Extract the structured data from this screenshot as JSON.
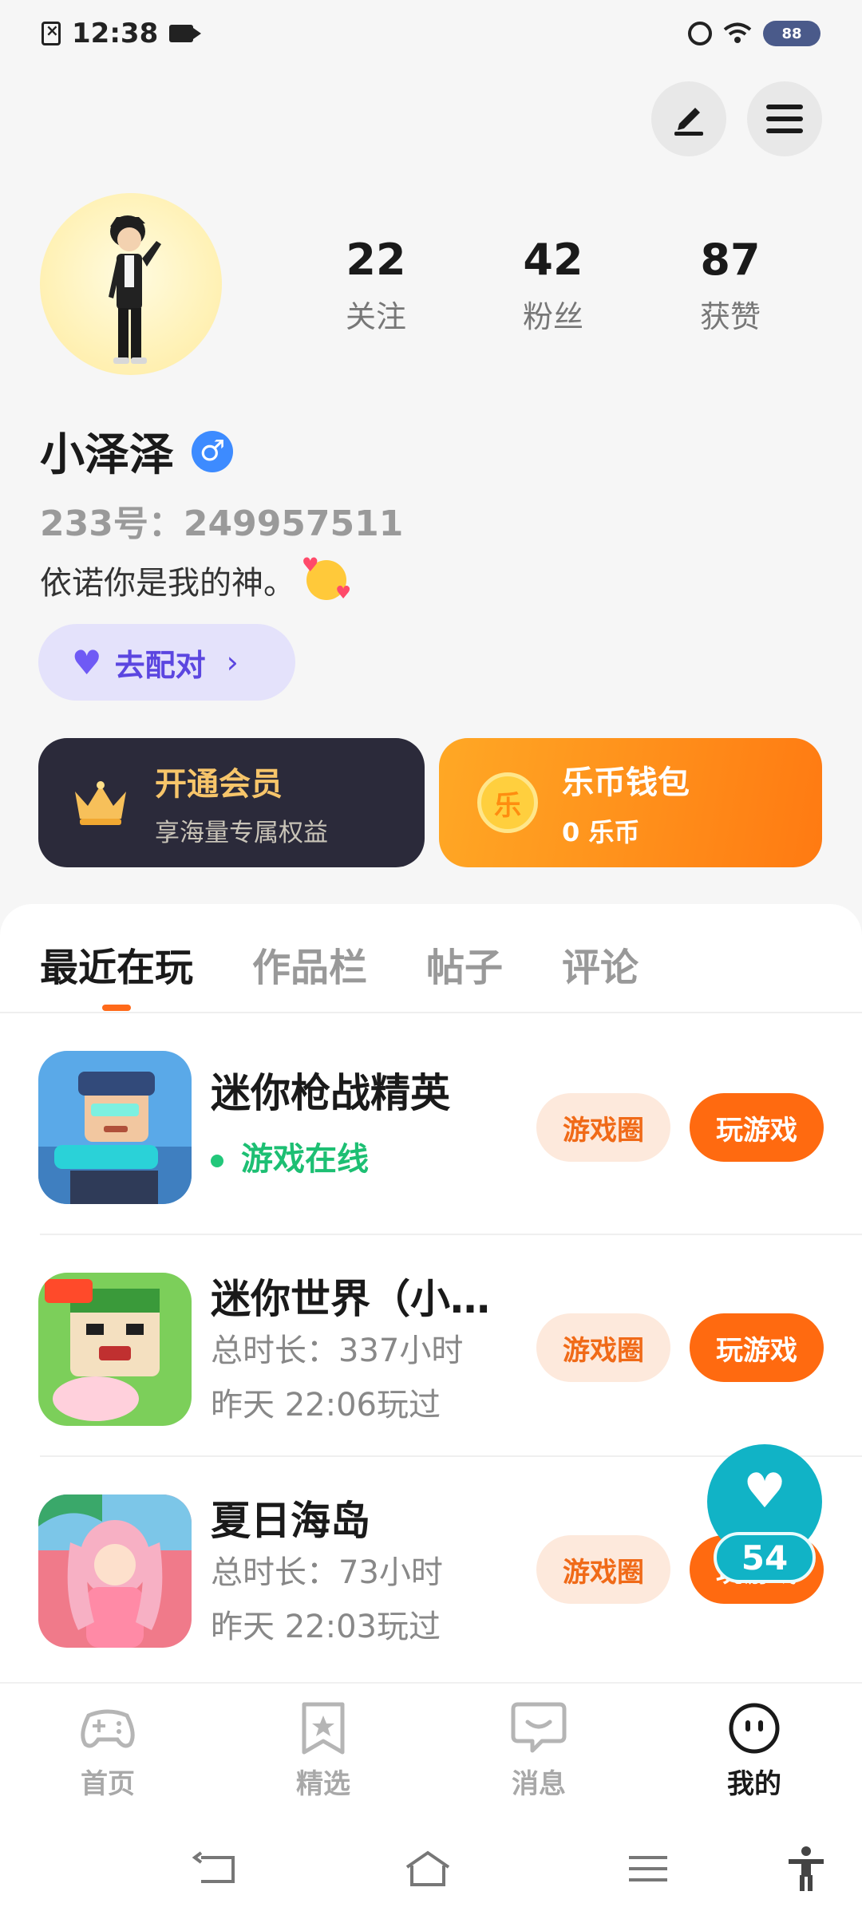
{
  "status_bar": {
    "time": "12:38",
    "battery": "88"
  },
  "profile": {
    "username": "小泽泽",
    "gender_symbol": "♂",
    "uid": "233号：249957511",
    "bio": "依诺你是我的神。",
    "stats": [
      {
        "value": "22",
        "label": "关注"
      },
      {
        "value": "42",
        "label": "粉丝"
      },
      {
        "value": "87",
        "label": "获赞"
      }
    ],
    "match_label": "去配对"
  },
  "cards": {
    "vip_title": "开通会员",
    "vip_subtitle": "享海量专属权益",
    "wallet_title": "乐币钱包",
    "wallet_balance": "0 乐币",
    "coin_glyph": "乐"
  },
  "tabs": [
    "最近在玩",
    "作品栏",
    "帖子",
    "评论"
  ],
  "games": [
    {
      "title": "迷你枪战精英",
      "line1": "游戏在线",
      "online": true,
      "circle_label": "游戏圈",
      "play_label": "玩游戏"
    },
    {
      "title": "迷你世界（小…",
      "line1": "总时长：337小时",
      "line2": "昨天  22:06玩过",
      "circle_label": "游戏圈",
      "play_label": "玩游戏"
    },
    {
      "title": "夏日海岛",
      "line1": "总时长：73小时",
      "line2": "昨天  22:03玩过",
      "circle_label": "游戏圈",
      "play_label": "玩游戏"
    }
  ],
  "like_float": {
    "count": "54"
  },
  "bottom_nav": [
    "首页",
    "精选",
    "消息",
    "我的"
  ],
  "colors": {
    "accent": "#ff6a10",
    "online": "#1dbf73",
    "like": "#11b3c6"
  }
}
